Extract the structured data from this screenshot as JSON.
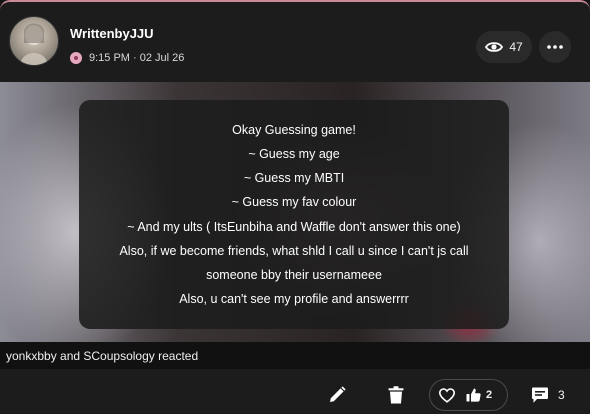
{
  "post": {
    "author": "WrittenbyJJU",
    "time": "9:15 PM · 02 Jul 26",
    "views": "47",
    "lines": [
      "Okay Guessing game!",
      "~ Guess my age",
      "~ Guess my MBTI",
      "~ Guess my fav colour",
      "~ And my ults ( ItsEunbiha and Waffle don't answer this one)",
      "Also, if we become friends, what shld I call u since I can't js call",
      "someone bby their usernameee",
      "Also, u can't see my profile and answerrrr"
    ],
    "reacted_text": "yonkxbby and SCoupsology reacted",
    "likes": "2",
    "comments": "3"
  },
  "colors": {
    "accent_border": "#c98a97",
    "background": "#1c1c1c",
    "icon": "#ffffff"
  },
  "icons": [
    "eye-icon",
    "more-icon",
    "edit-icon",
    "trash-icon",
    "heart-icon",
    "thumbs-up-icon",
    "comment-icon"
  ]
}
